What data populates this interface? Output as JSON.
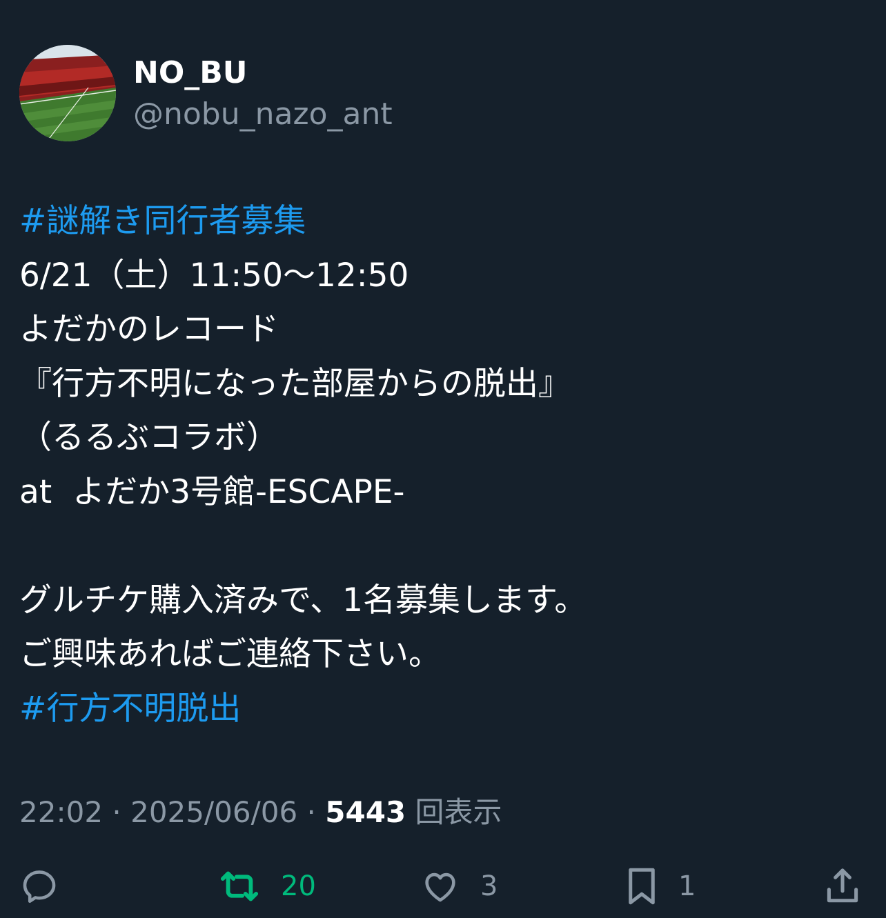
{
  "user": {
    "display_name": "NO_BU",
    "handle": "@nobu_nazo_ant",
    "avatar_icon": "stadium-photo-avatar"
  },
  "post": {
    "lines": [
      {
        "text": "#謎解き同行者募集",
        "type": "hashtag"
      },
      {
        "text": "6/21（土）11:50〜12:50",
        "type": "text"
      },
      {
        "text": "よだかのレコード",
        "type": "text"
      },
      {
        "text": "『行方不明になった部屋からの脱出』",
        "type": "text"
      },
      {
        "text": "（るるぶコラボ）",
        "type": "text"
      },
      {
        "text": "at  よだか3号館-ESCAPE-",
        "type": "text"
      },
      {
        "text": "",
        "type": "blank"
      },
      {
        "text": "グルチケ購入済みで、1名募集します。",
        "type": "text"
      },
      {
        "text": "ご興味あればご連絡下さい。",
        "type": "text"
      },
      {
        "text": "#行方不明脱出",
        "type": "hashtag"
      }
    ]
  },
  "meta": {
    "time": "22:02",
    "separator": " · ",
    "date": "2025/06/06",
    "views_count": "5443",
    "views_label": "回表示"
  },
  "actions": {
    "reply": {
      "icon": "reply-icon",
      "count": ""
    },
    "retweet": {
      "icon": "retweet-icon",
      "count": "20"
    },
    "like": {
      "icon": "heart-icon",
      "count": "3"
    },
    "bookmark": {
      "icon": "bookmark-icon",
      "count": "1"
    },
    "share": {
      "icon": "share-icon",
      "count": ""
    }
  },
  "colors": {
    "background": "#15202b",
    "text": "#ffffff",
    "secondary": "#8b98a5",
    "hashtag": "#1d9bf0",
    "retweet": "#00ba7c"
  }
}
